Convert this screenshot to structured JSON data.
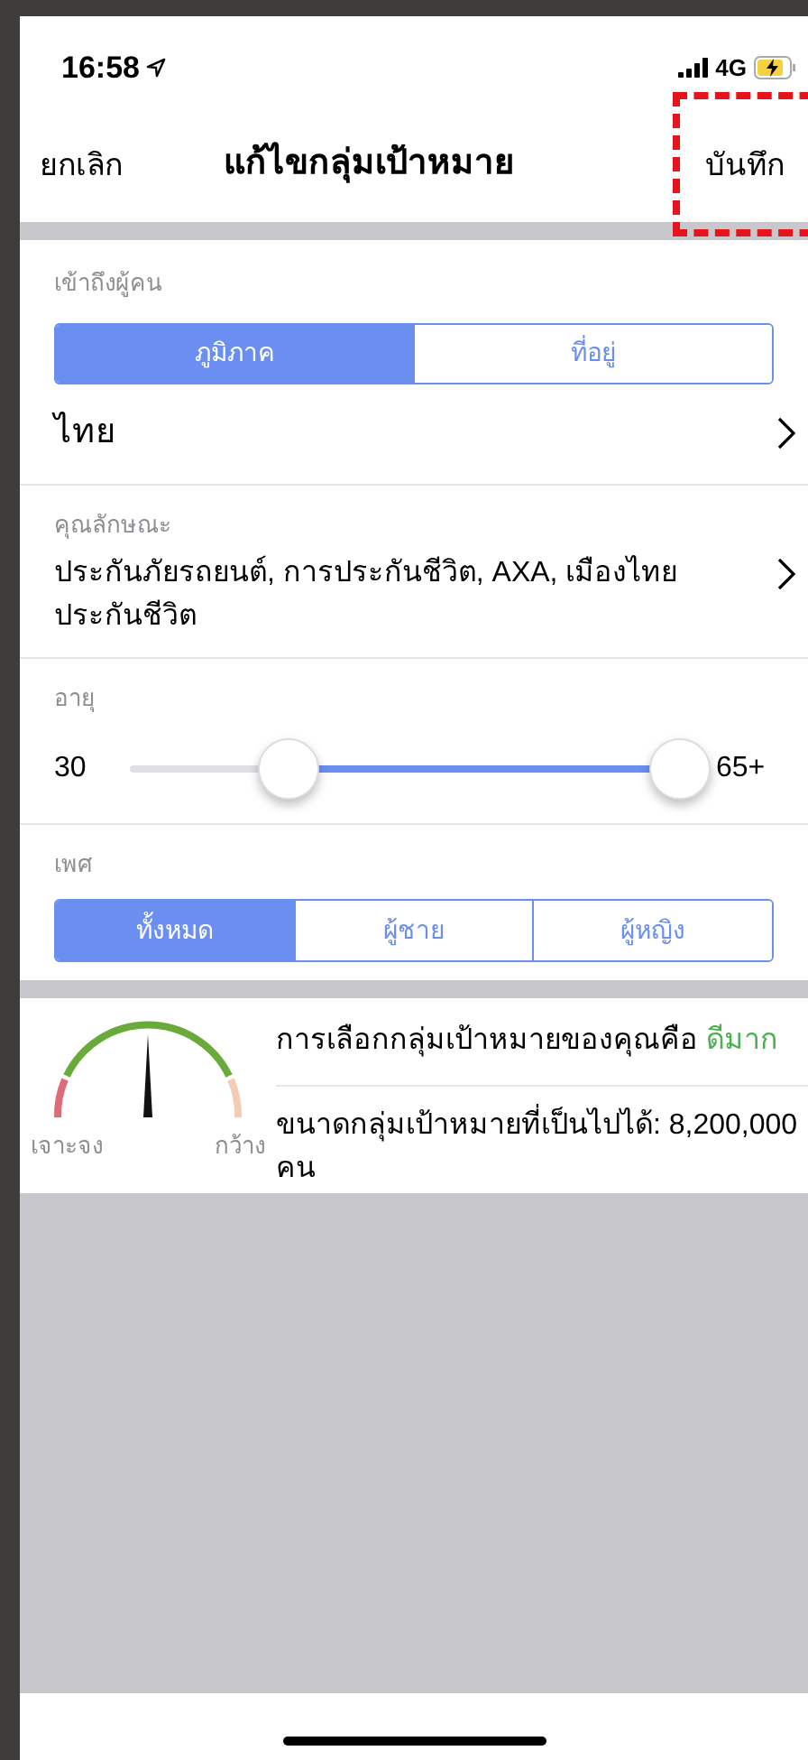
{
  "status_bar": {
    "time": "16:58",
    "network": "4G"
  },
  "nav": {
    "cancel": "ยกเลิก",
    "title": "แก้ไขกลุ่มเป้าหมาย",
    "save": "บันทึก",
    "save_highlighted": true
  },
  "reach": {
    "label": "เข้าถึงผู้คน",
    "tabs": [
      {
        "label": "ภูมิภาค",
        "selected": true
      },
      {
        "label": "ที่อยู่",
        "selected": false
      }
    ],
    "value": "ไทย"
  },
  "attributes": {
    "label": "คุณลักษณะ",
    "value": "ประกันภัยรถยนต์, การประกันชีวิต, AXA, เมืองไทยประกันชีวิต"
  },
  "age": {
    "label": "อายุ",
    "min": "30",
    "max": "65+",
    "thumbs": [
      {
        "level": 0.29
      },
      {
        "level": 1
      }
    ]
  },
  "gender": {
    "label": "เพศ",
    "tabs": [
      {
        "label": "ทั้งหมด",
        "selected": true
      },
      {
        "label": "ผู้ชาย",
        "selected": false
      },
      {
        "label": "ผู้หญิง",
        "selected": false
      }
    ]
  },
  "audience": {
    "left_label": "เจาะจง",
    "right_label": "กว้าง",
    "quality_text": "การเลือกกลุ่มเป้าหมายของคุณคือ",
    "quality_value": "ดีมาก",
    "size_text": "ขนาดกลุ่มเป้าหมายที่เป็นไปได้: 8,200,000 คน"
  }
}
